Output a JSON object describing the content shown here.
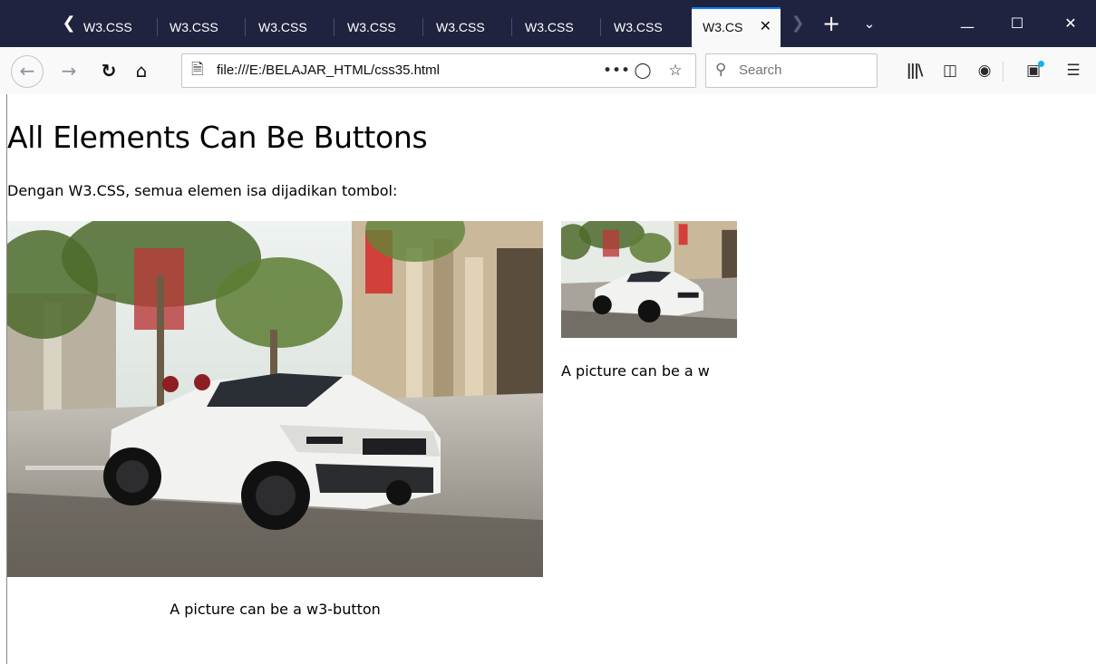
{
  "browser": {
    "tabs": [
      {
        "label": "W3.CSS",
        "active": false
      },
      {
        "label": "W3.CSS",
        "active": false
      },
      {
        "label": "W3.CSS",
        "active": false
      },
      {
        "label": "W3.CSS",
        "active": false
      },
      {
        "label": "W3.CSS",
        "active": false
      },
      {
        "label": "W3.CSS",
        "active": false
      },
      {
        "label": "W3.CSS",
        "active": false
      },
      {
        "label": "W3.CS",
        "active": true
      }
    ],
    "url": "file:///E:/BELAJAR_HTML/css35.html",
    "search_placeholder": "Search",
    "icons": {
      "tab_scroll_left": "chevron-left-icon",
      "tab_scroll_right": "chevron-right-icon",
      "new_tab": "plus-icon",
      "list_tabs": "chevron-down-icon",
      "minimize": "minimize-icon",
      "maximize": "maximize-icon",
      "close": "close-icon",
      "back": "arrow-left-icon",
      "forward": "arrow-right-icon",
      "reload": "reload-icon",
      "home": "home-icon",
      "page": "page-icon",
      "page_actions": "more-icon",
      "pocket": "pocket-icon",
      "bookmark": "star-icon",
      "search": "search-icon",
      "library": "library-icon",
      "sidebar": "sidebar-icon",
      "account": "account-icon",
      "whats_new": "gift-icon",
      "menu": "hamburger-icon"
    },
    "colors": {
      "tabstrip": "#202340",
      "active_tab_line": "#0a84ff",
      "toolbar": "#f9f9fa"
    }
  },
  "page": {
    "title": "All Elements Can Be Buttons",
    "description": "Dengan W3.CSS, semua elemen isa dijadikan tombol:",
    "cards": [
      {
        "caption": "A picture can be a w3-button",
        "image": "white convertible SUV on city street"
      },
      {
        "caption": "A picture can be a w",
        "image": "white convertible SUV on city street"
      }
    ]
  }
}
